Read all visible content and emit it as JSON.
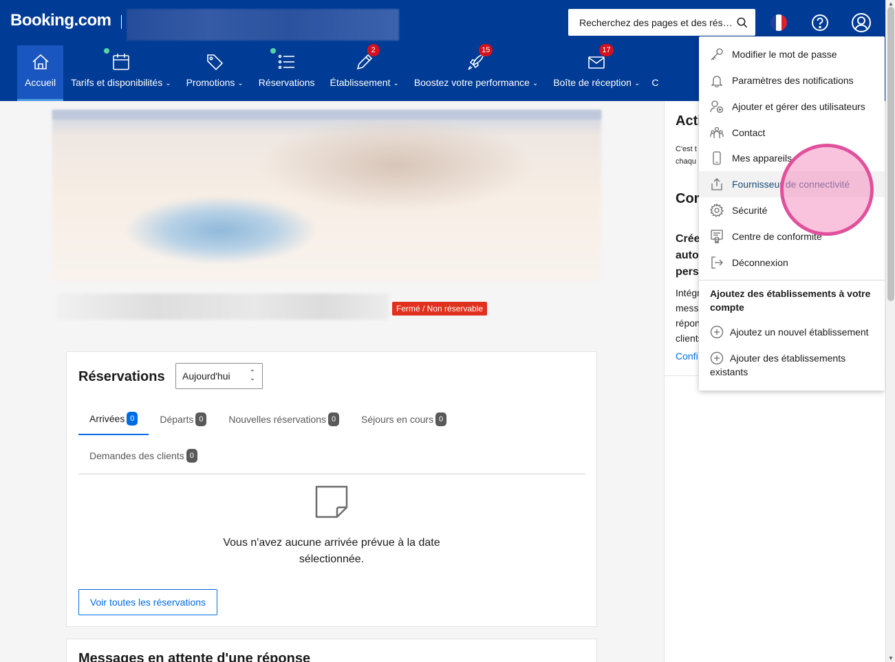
{
  "header": {
    "logo": "Booking.com",
    "search_placeholder": "Recherchez des pages et des rés…"
  },
  "nav": {
    "items": [
      {
        "label": "Accueil",
        "icon": "home-icon",
        "active": true
      },
      {
        "label": "Tarifs et disponibilités",
        "icon": "calendar-icon",
        "chevron": true,
        "dot": true
      },
      {
        "label": "Promotions",
        "icon": "tag-icon",
        "chevron": true
      },
      {
        "label": "Réservations",
        "icon": "list-icon",
        "dot": true
      },
      {
        "label": "Établissement",
        "icon": "pencil-icon",
        "chevron": true,
        "badge": "2"
      },
      {
        "label": "Boostez votre performance",
        "icon": "rocket-icon",
        "chevron": true,
        "badge": "15"
      },
      {
        "label": "Boîte de réception",
        "icon": "envelope-icon",
        "chevron": true,
        "badge": "17"
      },
      {
        "label": "C",
        "icon": "",
        "chevron": false
      }
    ]
  },
  "property": {
    "status": "Fermé / Non réservable"
  },
  "reservations": {
    "title": "Réservations",
    "period": "Aujourd'hui",
    "tabs": [
      {
        "label": "Arrivées",
        "count": "0",
        "active": true
      },
      {
        "label": "Départs",
        "count": "0"
      },
      {
        "label": "Nouvelles réservations",
        "count": "0"
      },
      {
        "label": "Séjours en cours",
        "count": "0"
      },
      {
        "label": "Demandes des clients",
        "count": "0"
      }
    ],
    "empty_message": "Vous n'avez aucune arrivée prévue à la date sélectionnée.",
    "see_all": "Voir toutes les réservations"
  },
  "messages": {
    "title": "Messages en attente d'une réponse"
  },
  "right_panel": {
    "activity_title": "Acti",
    "activity_desc_1": "C'est t",
    "activity_desc_2": "chaqu",
    "connect_title": "Con",
    "create_1": "Crée",
    "create_2": "auto",
    "create_3": "pers",
    "integ_1": "Intégr",
    "integ_2": "mess",
    "integ_3": "répon",
    "integ_4": "clients",
    "config": "Confi"
  },
  "account_menu": {
    "items": [
      {
        "label": "Modifier le mot de passe",
        "icon": "key-icon"
      },
      {
        "label": "Paramètres des notifications",
        "icon": "bell-icon"
      },
      {
        "label": "Ajouter et gérer des utilisateurs",
        "icon": "user-add-icon"
      },
      {
        "label": "Contact",
        "icon": "group-icon"
      },
      {
        "label": "Mes appareils",
        "icon": "phone-icon"
      },
      {
        "label": "Fournisseur de connectivité",
        "icon": "upload-icon",
        "hover": true
      },
      {
        "label": "Sécurité",
        "icon": "gear-icon"
      },
      {
        "label": "Centre de conformité",
        "icon": "certificate-icon"
      },
      {
        "label": "Déconnexion",
        "icon": "logout-icon"
      }
    ],
    "add_heading": "Ajoutez des établissements à votre compte",
    "add_new": "Ajoutez un nouvel établissement",
    "add_existing": "Ajouter des établissements existants"
  },
  "colors": {
    "brand": "#003b95",
    "nav_active": "#1a56c0",
    "link": "#006ce4",
    "badge": "#d4111e",
    "status": "#e0301e",
    "dot": "#55d6a8"
  }
}
